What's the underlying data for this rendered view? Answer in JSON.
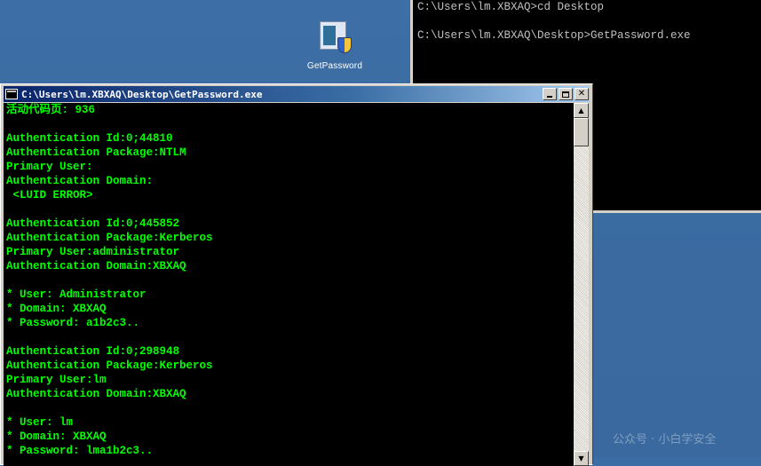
{
  "desktop": {
    "icon_label": "GetPassword"
  },
  "background_console": {
    "lines": [
      "C:\\Users\\lm.XBXAQ>cd Desktop",
      "",
      "C:\\Users\\lm.XBXAQ\\Desktop>GetPassword.exe"
    ]
  },
  "window": {
    "title": "C:\\Users\\lm.XBXAQ\\Desktop\\GetPassword.exe",
    "minimize_glyph": "_",
    "maximize_glyph": "□",
    "close_glyph": "✕"
  },
  "console": {
    "text_color": "#00ff00",
    "lines": [
      "活动代码页: 936",
      "",
      "Authentication Id:0;44810",
      "Authentication Package:NTLM",
      "Primary User:",
      "Authentication Domain:",
      " <LUID ERROR>",
      "",
      "Authentication Id:0;445852",
      "Authentication Package:Kerberos",
      "Primary User:administrator",
      "Authentication Domain:XBXAQ",
      "",
      "* User: Administrator",
      "* Domain: XBXAQ",
      "* Password: a1b2c3..",
      "",
      "Authentication Id:0;298948",
      "Authentication Package:Kerberos",
      "Primary User:lm",
      "Authentication Domain:XBXAQ",
      "",
      "* User: lm",
      "* Domain: XBXAQ",
      "* Password: lma1b2c3.."
    ]
  },
  "scrollbar": {
    "up_glyph": "▲",
    "down_glyph": "▼"
  },
  "watermark": {
    "text": "公众号 · 小白学安全"
  }
}
